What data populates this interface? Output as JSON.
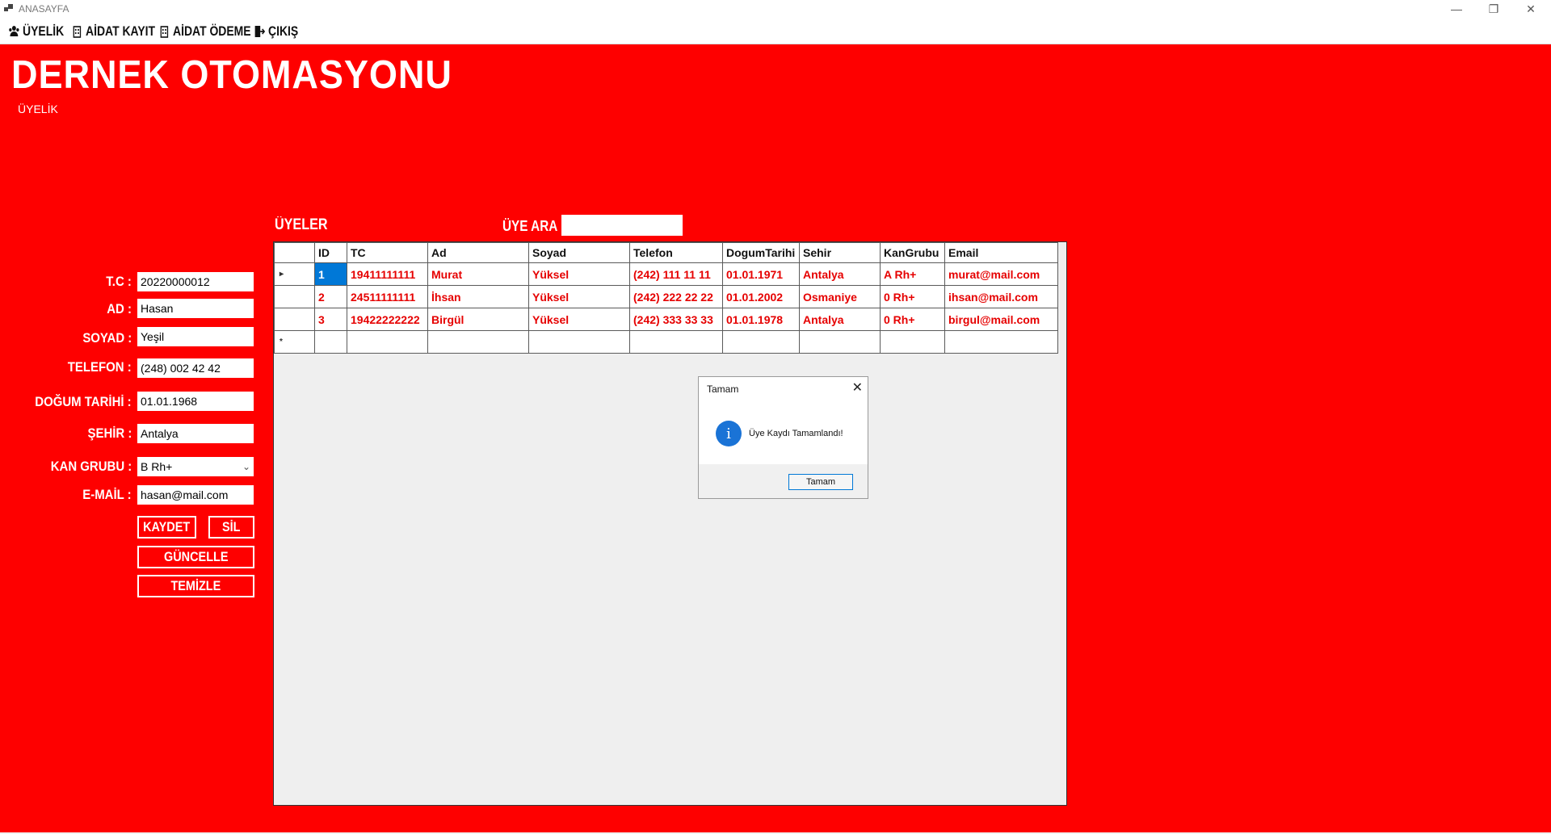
{
  "window": {
    "title": "ANASAYFA",
    "minimize_glyph": "—",
    "restore_glyph": "❐",
    "close_glyph": "✕"
  },
  "menu": [
    {
      "label": "ÜYELİK",
      "icon": "users-icon"
    },
    {
      "label": "AİDAT KAYIT",
      "icon": "building-icon"
    },
    {
      "label": "AİDAT ÖDEME",
      "icon": "building-icon"
    },
    {
      "label": "ÇIKIŞ",
      "icon": "exit-icon"
    }
  ],
  "header": {
    "app_title": "DERNEK OTOMASYONU",
    "section": "ÜYELİK"
  },
  "form": {
    "tc_label": "T.C :",
    "tc_value": "20220000012",
    "ad_label": "AD :",
    "ad_value": "Hasan",
    "soyad_label": "SOYAD :",
    "soyad_value": "Yeşil",
    "telefon_label": "TELEFON :",
    "telefon_value": "(248) 002 42 42",
    "dogum_label": "DOĞUM TARİHİ :",
    "dogum_value": "01.01.1968",
    "sehir_label": "ŞEHİR :",
    "sehir_value": "Antalya",
    "kan_label": "KAN GRUBU :",
    "kan_value": "B Rh+",
    "email_label": "E-MAİL :",
    "email_value": "hasan@mail.com"
  },
  "buttons": {
    "kaydet": "KAYDET",
    "sil": "SİL",
    "guncelle": "GÜNCELLE",
    "temizle": "TEMİZLE"
  },
  "grid": {
    "title": "ÜYELER",
    "search_label": "ÜYE ARA",
    "search_value": "",
    "columns": [
      "ID",
      "TC",
      "Ad",
      "Soyad",
      "Telefon",
      "DogumTarihi",
      "Sehir",
      "KanGrubu",
      "Email"
    ],
    "rows": [
      [
        "1",
        "19411111111",
        "Murat",
        "Yüksel",
        "(242) 111 11 11",
        "01.01.1971",
        "Antalya",
        "A Rh+",
        "murat@mail.com"
      ],
      [
        "2",
        "24511111111",
        "İhsan",
        "Yüksel",
        "(242) 222 22 22",
        "01.01.2002",
        "Osmaniye",
        "0 Rh+",
        "ihsan@mail.com"
      ],
      [
        "3",
        "19422222222",
        "Birgül",
        "Yüksel",
        "(242) 333 33 33",
        "01.01.1978",
        "Antalya",
        "0 Rh+",
        "birgul@mail.com"
      ]
    ],
    "current_row_glyph": "▸",
    "new_row_glyph": "*"
  },
  "dialog": {
    "title": "Tamam",
    "message": "Üye Kaydı Tamamlandı!",
    "ok_label": "Tamam",
    "close_glyph": "✕",
    "info_glyph": "i"
  },
  "colors": {
    "background": "#fe0000",
    "cell_text": "#e60000",
    "selection": "#0078d7"
  }
}
